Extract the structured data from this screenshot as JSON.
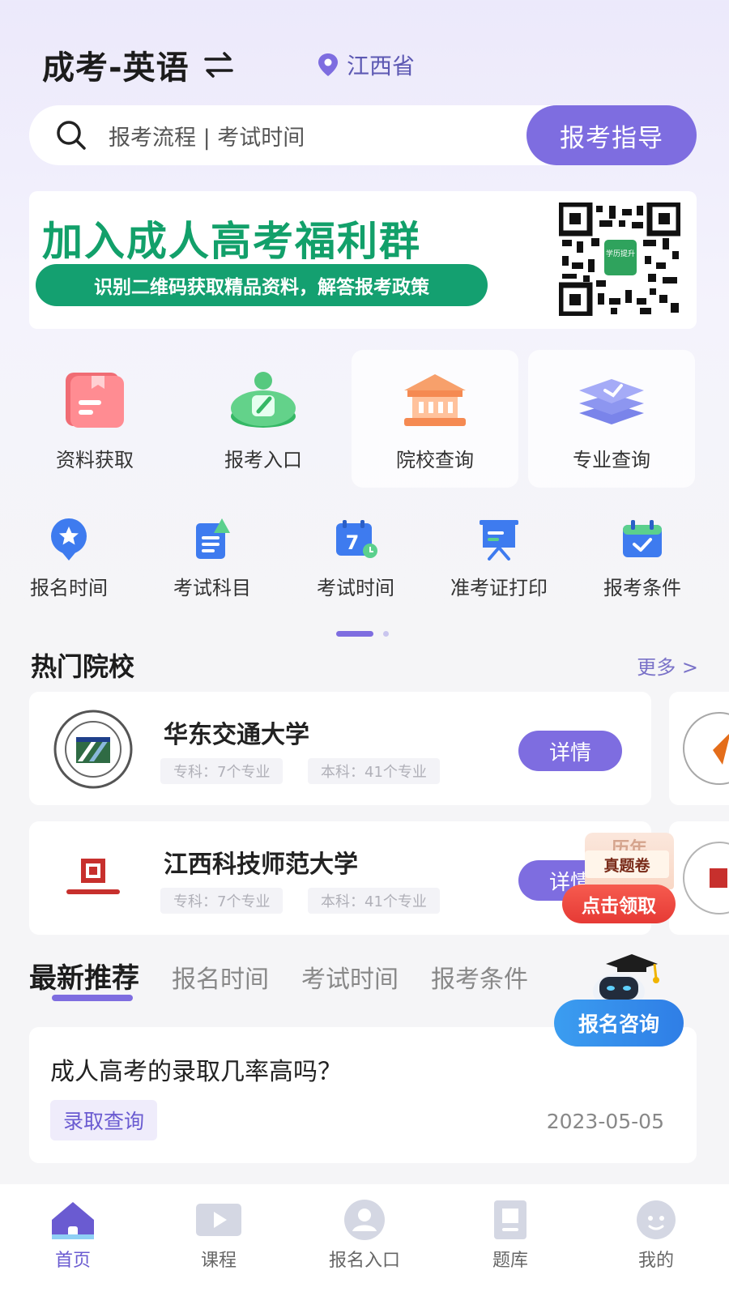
{
  "header": {
    "title": "成考-英语",
    "location": "江西省"
  },
  "search": {
    "placeholder": "报考流程 | 考试时间",
    "guide_label": "报考指导"
  },
  "banner": {
    "title": "加入成人高考福利群",
    "subtitle": "识别二维码获取精品资料，解答报考政策",
    "qr_badge": "学历提升"
  },
  "tiles": [
    {
      "label": "资料获取",
      "icon": "folder-icon"
    },
    {
      "label": "报考入口",
      "icon": "edit-icon"
    },
    {
      "label": "院校查询",
      "icon": "school-icon"
    },
    {
      "label": "专业查询",
      "icon": "layers-icon"
    }
  ],
  "mini": [
    {
      "label": "报名时间",
      "icon": "star-badge-icon"
    },
    {
      "label": "考试科目",
      "icon": "document-icon"
    },
    {
      "label": "考试时间",
      "icon": "calendar-clock-icon",
      "day": "7"
    },
    {
      "label": "准考证打印",
      "icon": "easel-icon"
    },
    {
      "label": "报考条件",
      "icon": "calendar-check-icon"
    }
  ],
  "pagination": {
    "pages": 2,
    "active": 1
  },
  "hot_schools": {
    "title": "热门院校",
    "more": "更多 >",
    "items": [
      {
        "name": "华东交通大学",
        "tag1": "专科：7个专业",
        "tag2": "本科：41个专业",
        "button": "详情"
      },
      {
        "name": "江西科技师范大学",
        "tag1": "专科：7个专业",
        "tag2": "本科：41个专业",
        "button": "详情"
      }
    ]
  },
  "promo": {
    "top": "历年",
    "mid": "真题卷",
    "button": "点击领取"
  },
  "recommend": {
    "tabs": [
      "最新推荐",
      "报名时间",
      "考试时间",
      "报考条件"
    ],
    "article": {
      "title": "成人高考的录取几率高吗？",
      "tag": "录取查询",
      "date": "2023-05-05"
    }
  },
  "consult": {
    "label": "报名咨询"
  },
  "nav": [
    {
      "label": "首页",
      "icon": "home-icon",
      "active": true
    },
    {
      "label": "课程",
      "icon": "video-icon",
      "active": false
    },
    {
      "label": "报名入口",
      "icon": "user-icon",
      "active": false
    },
    {
      "label": "题库",
      "icon": "book-icon",
      "active": false
    },
    {
      "label": "我的",
      "icon": "profile-icon",
      "active": false
    }
  ],
  "colors": {
    "accent": "#7e6de0",
    "green": "#14a070",
    "blue": "#2f7ee6",
    "red": "#e63a35"
  }
}
